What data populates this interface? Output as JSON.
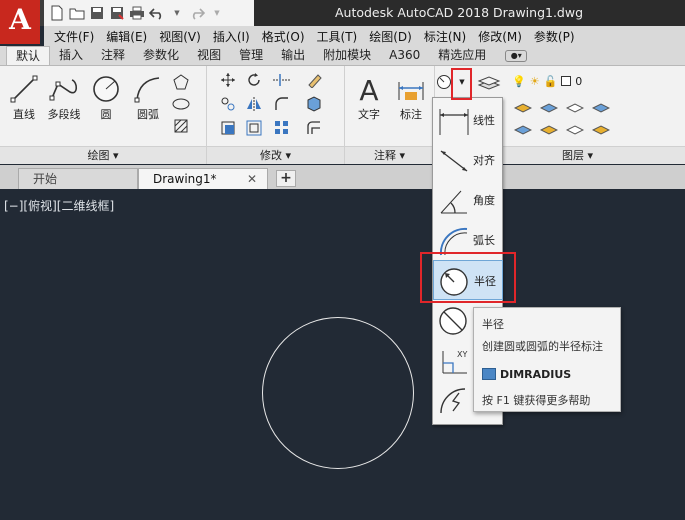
{
  "window": {
    "title": "Autodesk AutoCAD 2018    Drawing1.dwg",
    "logo": "A"
  },
  "menu": [
    "文件(F)",
    "编辑(E)",
    "视图(V)",
    "插入(I)",
    "格式(O)",
    "工具(T)",
    "绘图(D)",
    "标注(N)",
    "修改(M)",
    "参数(P)"
  ],
  "ribbon_tabs": [
    "默认",
    "插入",
    "注释",
    "参数化",
    "视图",
    "管理",
    "输出",
    "附加模块",
    "A360",
    "精选应用"
  ],
  "panels": {
    "draw": {
      "footer": "绘图 ▾",
      "buttons": [
        "直线",
        "多段线",
        "圆",
        "圆弧"
      ]
    },
    "modify": {
      "footer": "修改 ▾"
    },
    "annotation": {
      "footer": "注释 ▾",
      "buttons": [
        "文字",
        "标注"
      ]
    },
    "layers": {
      "footer": "图层 ▾",
      "layer_value": "0"
    }
  },
  "doc_tabs": {
    "start": "开始",
    "drawing": "Drawing1*",
    "close": "✕",
    "new": "+"
  },
  "viewport_label": "[−][俯视][二维线框]",
  "dimension_menu": {
    "items": [
      "线性",
      "对齐",
      "角度",
      "弧长",
      "半径",
      "直径",
      "坐标",
      "折弯"
    ],
    "selected": "半径"
  },
  "tooltip": {
    "title": "半径",
    "description": "创建圆或圆弧的半径标注",
    "command": "DIMRADIUS",
    "help": "按 F1 键获得更多帮助"
  },
  "colors": {
    "highlight": "#e0262a",
    "canvas": "#222a35",
    "logo": "#c8281e"
  }
}
